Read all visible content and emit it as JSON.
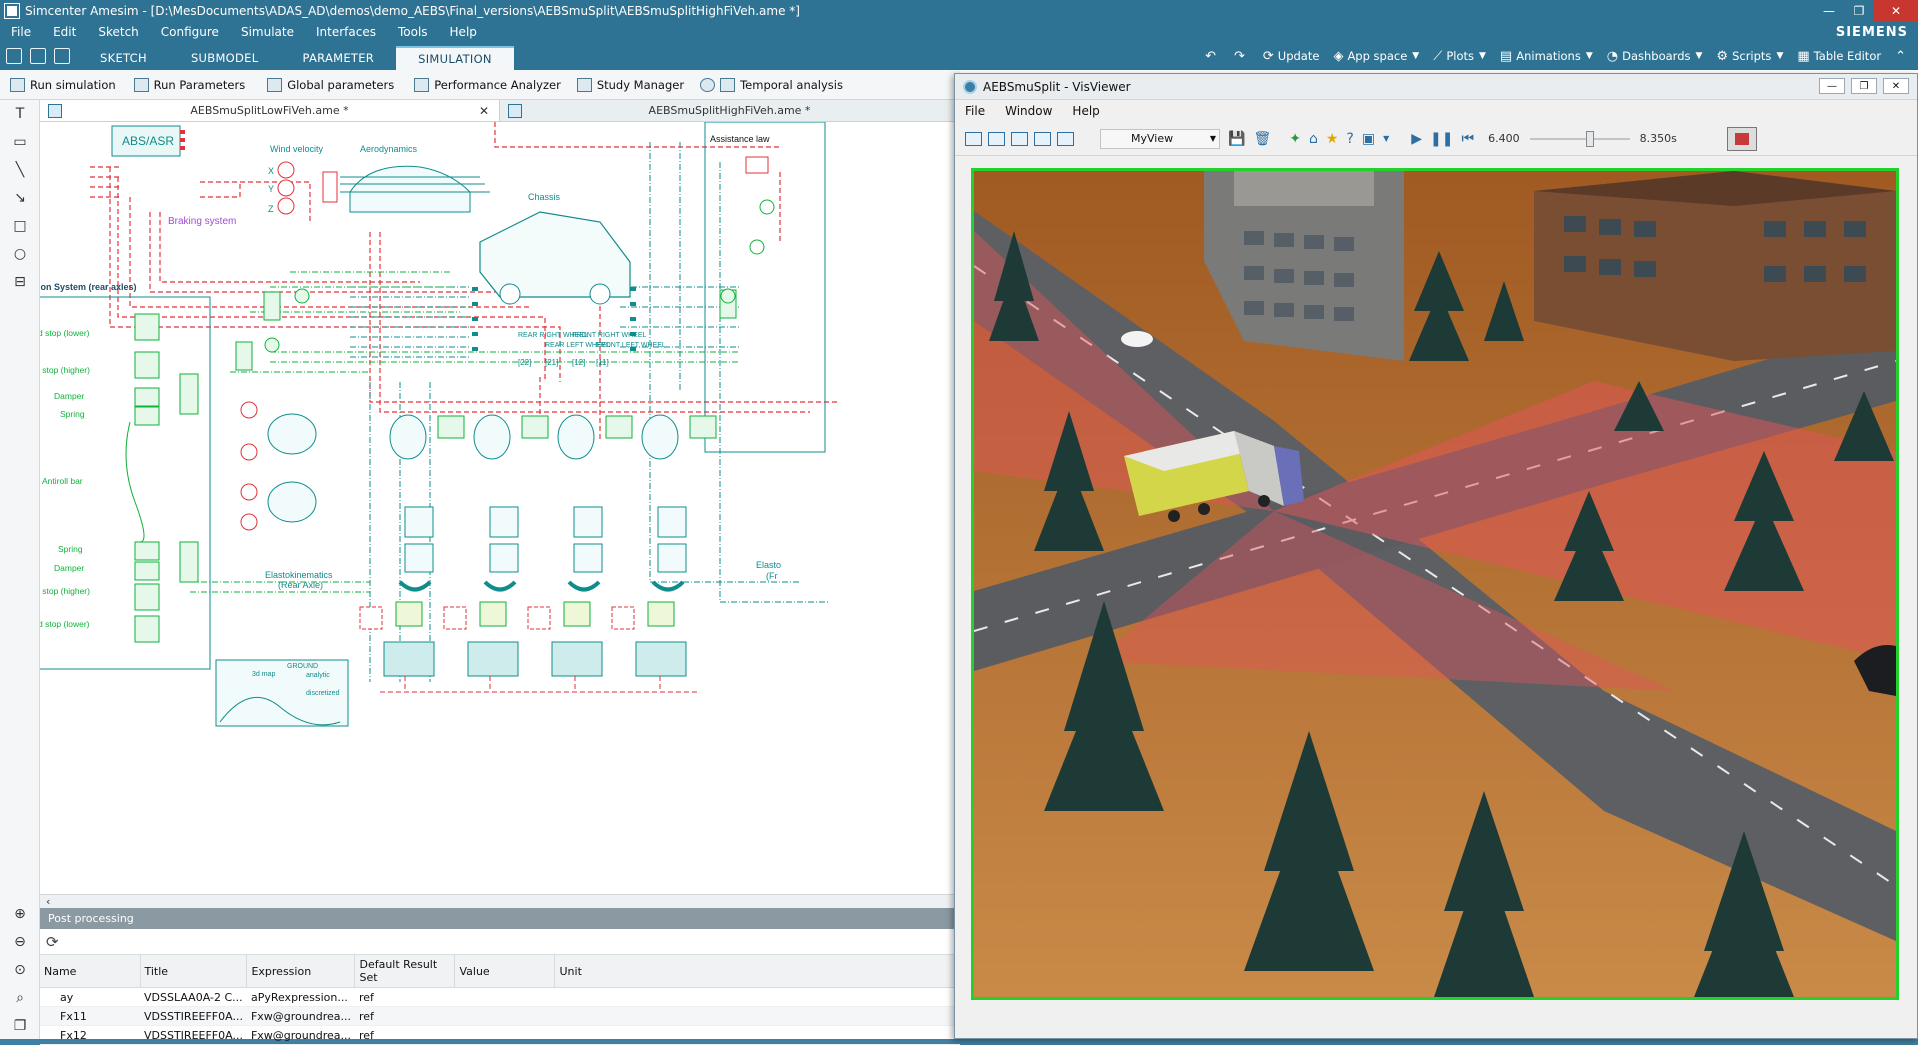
{
  "window": {
    "title": "Simcenter Amesim - [D:\\MesDocuments\\ADAS_AD\\demos\\demo_AEBS\\Final_versions\\AEBSmuSplit\\AEBSmuSplitHighFiVeh.ame *]",
    "brand": "SIEMENS"
  },
  "menu": [
    "File",
    "Edit",
    "Sketch",
    "Configure",
    "Simulate",
    "Interfaces",
    "Tools",
    "Help"
  ],
  "tabs": [
    {
      "label": "SKETCH",
      "active": false
    },
    {
      "label": "SUBMODEL",
      "active": false
    },
    {
      "label": "PARAMETER",
      "active": false
    },
    {
      "label": "SIMULATION",
      "active": true
    }
  ],
  "ribbon_tools": {
    "update": "Update",
    "app_space": "App space",
    "plots": "Plots",
    "animations": "Animations",
    "dashboards": "Dashboards",
    "scripts": "Scripts",
    "table_editor": "Table Editor"
  },
  "commands": {
    "run_simulation": "Run simulation",
    "run_parameters": "Run Parameters",
    "global_parameters": "Global parameters",
    "performance_analyzer": "Performance Analyzer",
    "study_manager": "Study Manager",
    "temporal_analysis": "Temporal analysis"
  },
  "doc_tabs": [
    {
      "label": "AEBSmuSplitLowFiVeh.ame *",
      "active": true,
      "closable": true
    },
    {
      "label": "AEBSmuSplitHighFiVeh.ame *",
      "active": false,
      "closable": false
    }
  ],
  "sketch_labels": {
    "abs": "ABS/ASR",
    "wind": "Wind velocity",
    "aero": "Aerodynamics",
    "chassis": "Chassis",
    "braking": "Braking system",
    "assist": "Assistance law",
    "suspension": "ion System (rear axles)",
    "stop_lower": "d stop (lower)",
    "stop_higher": "l stop (higher)",
    "damper": "Damper",
    "spring": "Spring",
    "antiroll": "Antiroll bar",
    "spring2": "Spring",
    "damper2": "Damper",
    "stop_higher2": "l stop (higher)",
    "stop_lower2": "d stop (lower)",
    "elasto_rear": "Elastokinematics",
    "elasto_rear2": "(Rear Axle)",
    "elasto_front": "Elasto",
    "elasto_front2": "(Fr",
    "wheel_rr": "REAR RIGHT WHEEL",
    "wheel_rl": "REAR LEFT WHEEL",
    "wheel_fr": "FRONT RIGHT WHEEL",
    "wheel_fl": "FRONT LEFT WHEEL",
    "idx1": "[22]",
    "idx2": "[21]",
    "idx3": "[12]",
    "idx4": "[11]",
    "ground": "GROUND",
    "map3d": "3d map",
    "analytic": "analytic",
    "discretized": "discretized",
    "x": "X",
    "y": "Y",
    "z": "Z"
  },
  "post": {
    "header": "Post processing",
    "columns": [
      "Name",
      "Title",
      "Expression",
      "Default Result Set",
      "Value",
      "Unit"
    ],
    "rows": [
      {
        "name": "ay",
        "title": "VDSSLAA0A-2 C...",
        "expression": "aPyRexpression...",
        "result_set": "ref",
        "value": "",
        "unit": ""
      },
      {
        "name": "Fx11",
        "title": "VDSSTIREEFF0A...",
        "expression": "Fxw@groundrea...",
        "result_set": "ref",
        "value": "",
        "unit": ""
      },
      {
        "name": "Fx12",
        "title": "VDSSTIREEFF0A...",
        "expression": "Fxw@groundrea...",
        "result_set": "ref",
        "value": "",
        "unit": ""
      }
    ]
  },
  "visviewer": {
    "title": "AEBSmuSplit - VisViewer",
    "menu": [
      "File",
      "Window",
      "Help"
    ],
    "view": "MyView",
    "time_start": "6.400",
    "time_end": "8.350s",
    "slider_fraction": 0.6
  },
  "colors": {
    "frame": "#2f7394",
    "sketch_green": "#0fb23a",
    "sketch_teal": "#0f8c8c",
    "sketch_red": "#e2323a",
    "viewport_border": "#22d12a"
  }
}
